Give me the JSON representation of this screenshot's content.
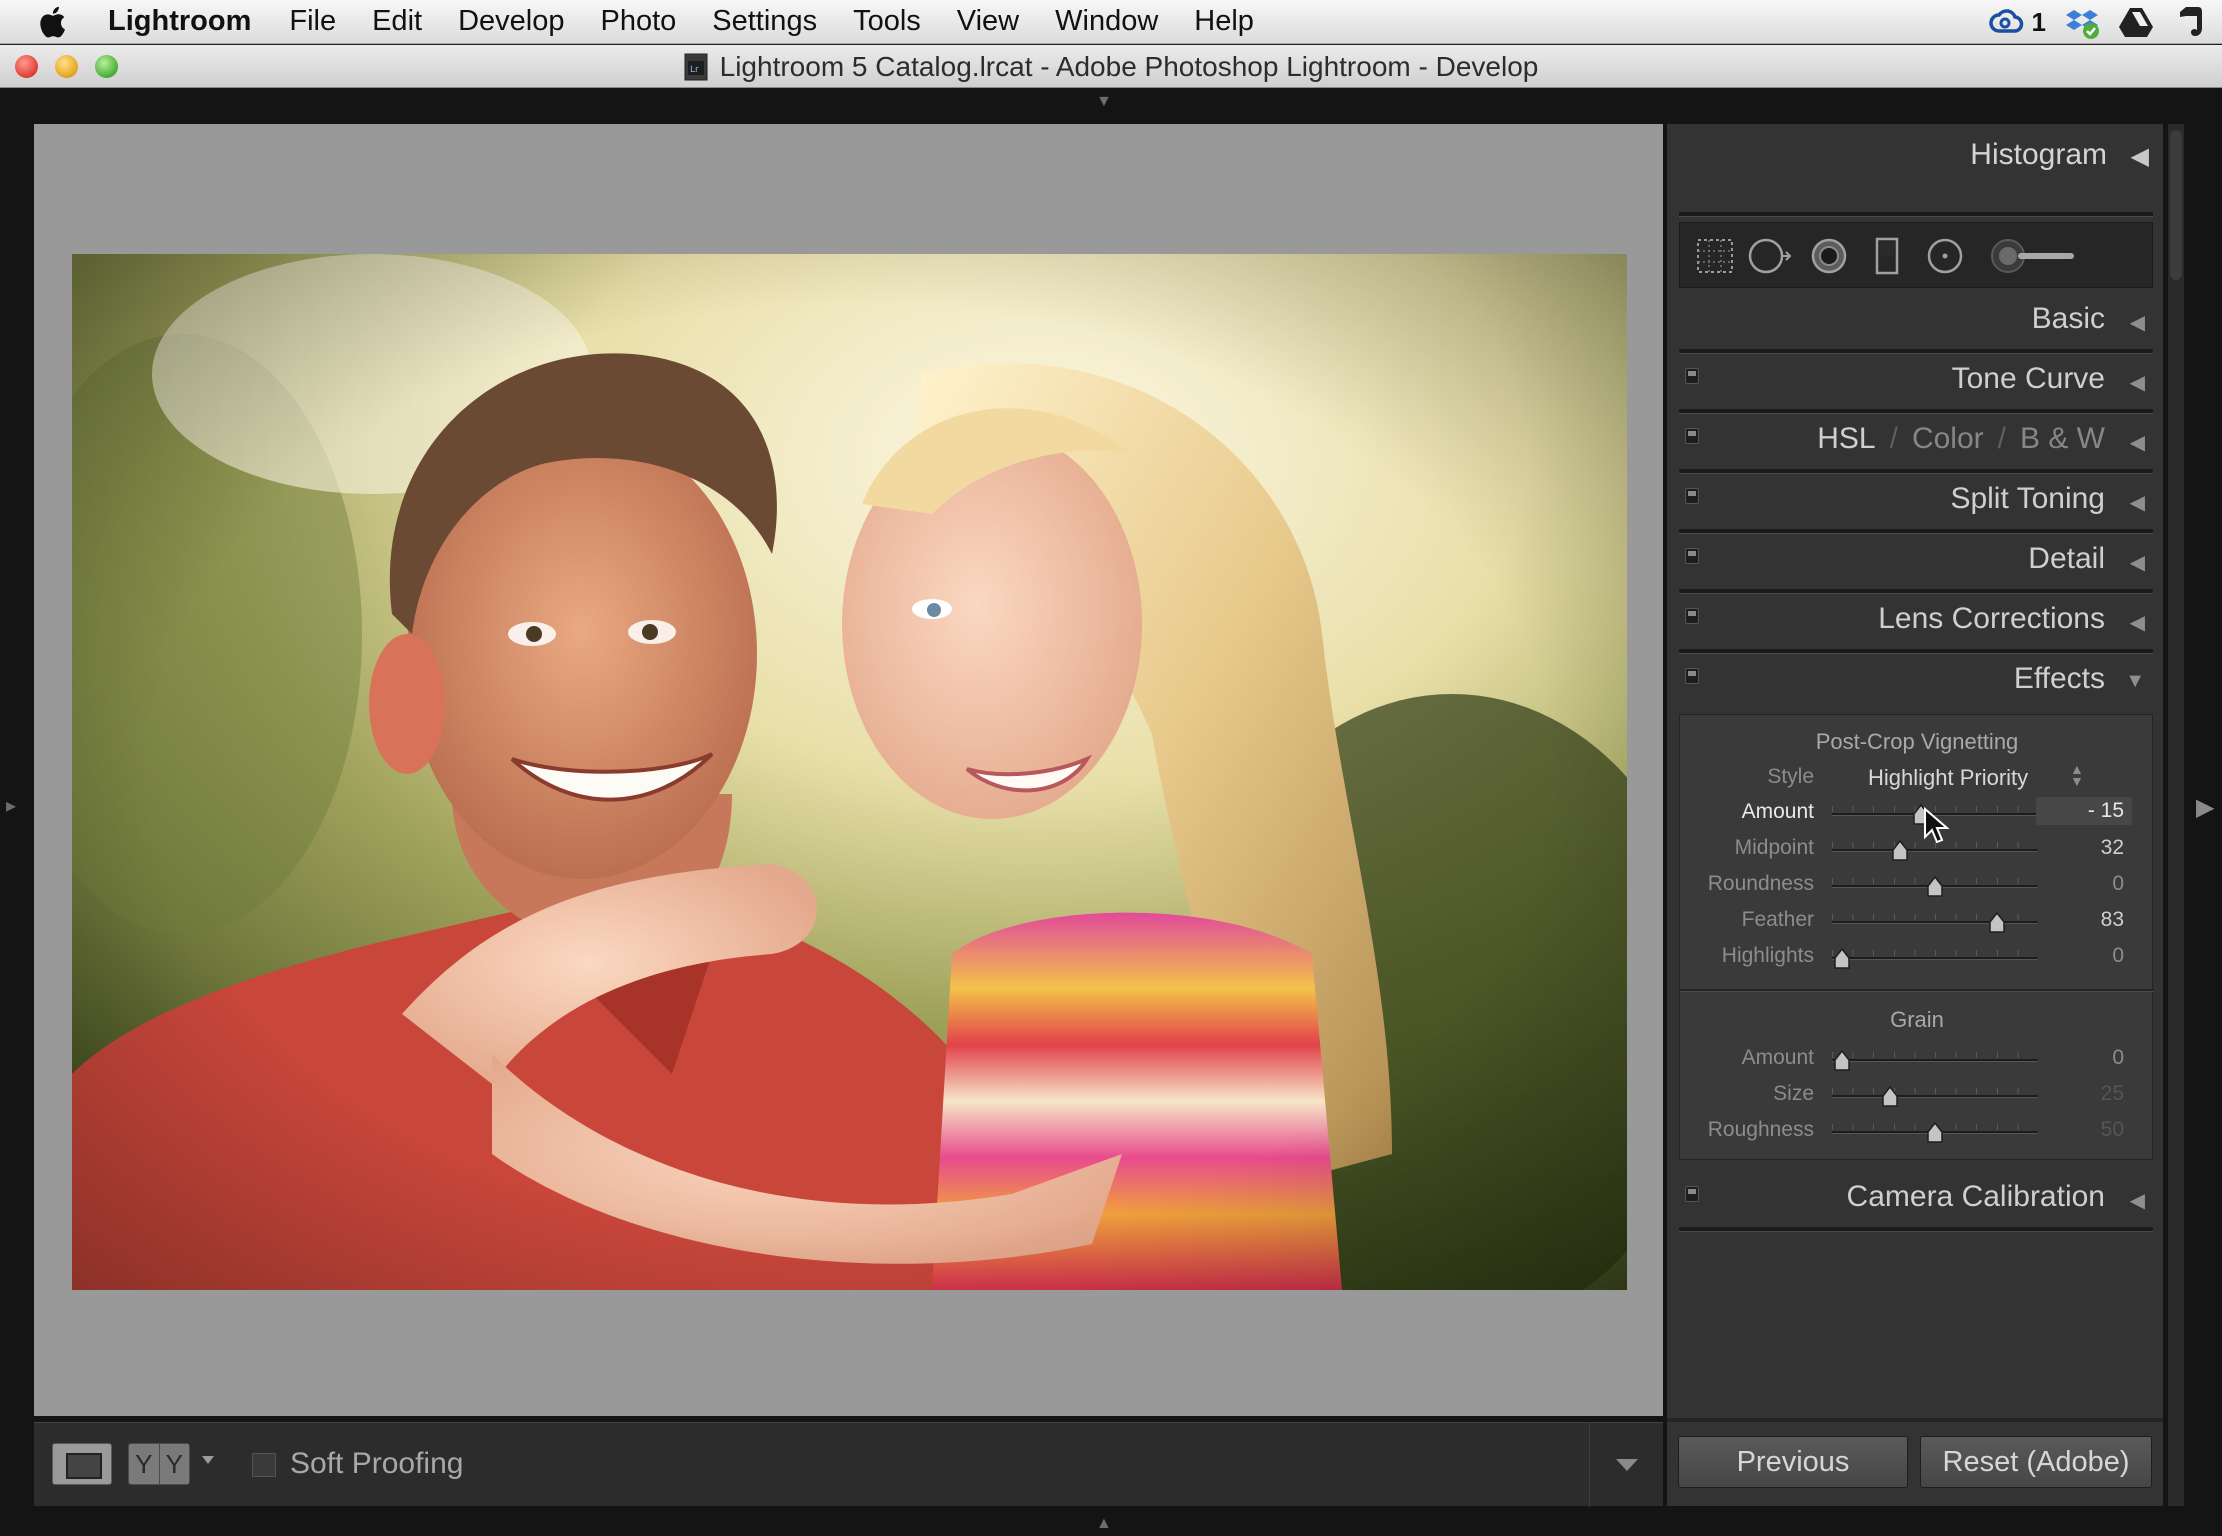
{
  "menubar": {
    "app_name": "Lightroom",
    "items": [
      "File",
      "Edit",
      "Develop",
      "Photo",
      "Settings",
      "Tools",
      "View",
      "Window",
      "Help"
    ],
    "creative_cloud_count": "1"
  },
  "window": {
    "title": "Lightroom 5 Catalog.lrcat - Adobe Photoshop Lightroom - Develop"
  },
  "panels": {
    "histogram": "Histogram",
    "basic": "Basic",
    "tone_curve": "Tone Curve",
    "hsl": {
      "hsl": "HSL",
      "sep": "/",
      "color": "Color",
      "bw": "B & W"
    },
    "split_toning": "Split Toning",
    "detail": "Detail",
    "lens_corrections": "Lens Corrections",
    "effects": "Effects",
    "camera_calibration": "Camera Calibration"
  },
  "tools": [
    "crop-overlay",
    "spot-removal",
    "red-eye-correction",
    "graduated-filter",
    "radial-filter",
    "adjustment-brush"
  ],
  "effects": {
    "vignette_heading": "Post-Crop Vignetting",
    "style_label": "Style",
    "style_value": "Highlight Priority",
    "vignette_sliders": [
      {
        "label": "Amount",
        "value": "- 15",
        "position": 0.43
      },
      {
        "label": "Midpoint",
        "value": "32",
        "position": 0.33
      },
      {
        "label": "Roundness",
        "value": "0",
        "position": 0.5
      },
      {
        "label": "Feather",
        "value": "83",
        "position": 0.8
      },
      {
        "label": "Highlights",
        "value": "0",
        "position": 0.05
      }
    ],
    "grain_heading": "Grain",
    "grain_sliders": [
      {
        "label": "Amount",
        "value": "0",
        "position": 0.05
      },
      {
        "label": "Size",
        "value": "25",
        "position": 0.28
      },
      {
        "label": "Roughness",
        "value": "50",
        "position": 0.5
      }
    ]
  },
  "toolbar": {
    "soft_proofing": "Soft Proofing",
    "compare_left": "Y",
    "compare_right": "Y"
  },
  "buttons": {
    "previous": "Previous",
    "reset": "Reset (Adobe)"
  },
  "colors": {
    "panel_bg": "#333333",
    "canvas_bg": "#999999",
    "shirt_red": "#c8463a",
    "top_pink": "#d8408a"
  }
}
